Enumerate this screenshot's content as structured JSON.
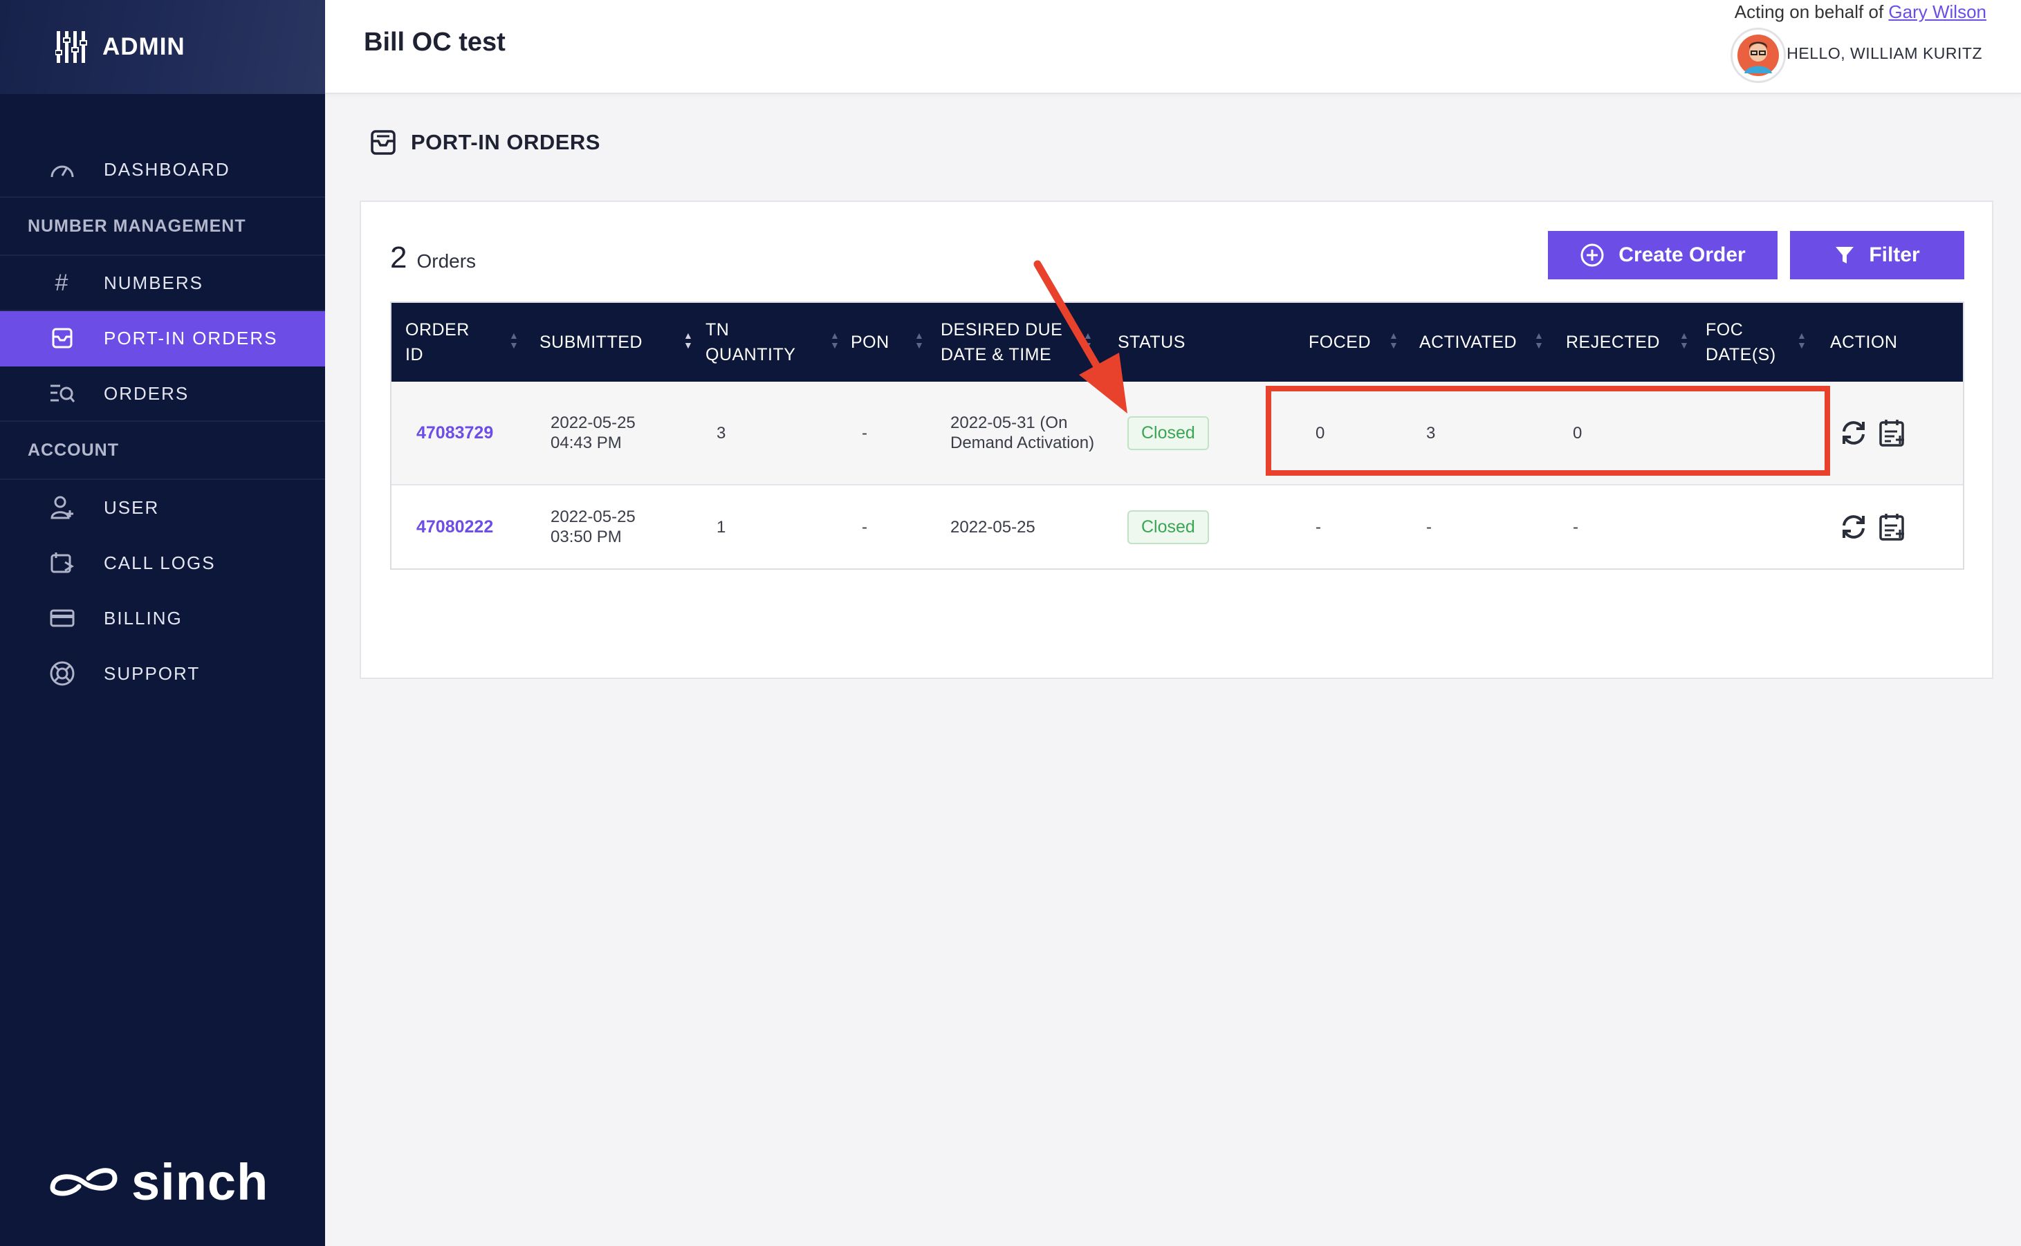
{
  "sidebar": {
    "brand": "ADMIN",
    "items": [
      {
        "label": "DASHBOARD",
        "icon": "gauge-icon"
      },
      {
        "section": "NUMBER MANAGEMENT"
      },
      {
        "label": "NUMBERS",
        "icon": "hash-icon"
      },
      {
        "label": "PORT-IN ORDERS",
        "icon": "inbox-icon",
        "active": true
      },
      {
        "label": "ORDERS",
        "icon": "search-list-icon"
      },
      {
        "section": "ACCOUNT"
      },
      {
        "label": "USER",
        "icon": "user-plus-icon"
      },
      {
        "label": "CALL LOGS",
        "icon": "call-log-icon"
      },
      {
        "label": "BILLING",
        "icon": "credit-card-icon"
      },
      {
        "label": "SUPPORT",
        "icon": "lifebuoy-icon"
      }
    ],
    "footer_logo": "sinch"
  },
  "topbar": {
    "account_name": "Bill OC test",
    "acting_prefix": "Acting on behalf of",
    "acting_user": "Gary Wilson",
    "hello": "HELLO, WILLIAM KURITZ"
  },
  "page": {
    "title": "PORT-IN ORDERS"
  },
  "orders": {
    "count": "2",
    "count_label": "Orders",
    "create_label": "Create Order",
    "filter_label": "Filter",
    "columns": [
      "ORDER ID",
      "SUBMITTED",
      "TN QUANTITY",
      "PON",
      "DESIRED DUE DATE & TIME",
      "STATUS",
      "FOCED",
      "ACTIVATED",
      "REJECTED",
      "FOC DATE(S)",
      "ACTION"
    ],
    "rows": [
      {
        "order_id": "47083729",
        "submitted_date": "2022-05-25",
        "submitted_time": "04:43 PM",
        "tn_quantity": "3",
        "pon": "-",
        "due": "2022-05-31 (On Demand Activation)",
        "status": "Closed",
        "foced": "0",
        "activated": "3",
        "rejected": "0",
        "foc_dates": ""
      },
      {
        "order_id": "47080222",
        "submitted_date": "2022-05-25",
        "submitted_time": "03:50 PM",
        "tn_quantity": "1",
        "pon": "-",
        "due": "2022-05-25",
        "status": "Closed",
        "foced": "-",
        "activated": "-",
        "rejected": "-",
        "foc_dates": ""
      }
    ]
  },
  "colors": {
    "sidebar_bg": "#0c1739",
    "accent": "#6c4de6",
    "status_green": "#3aa552",
    "annotation_red": "#e8412c"
  }
}
